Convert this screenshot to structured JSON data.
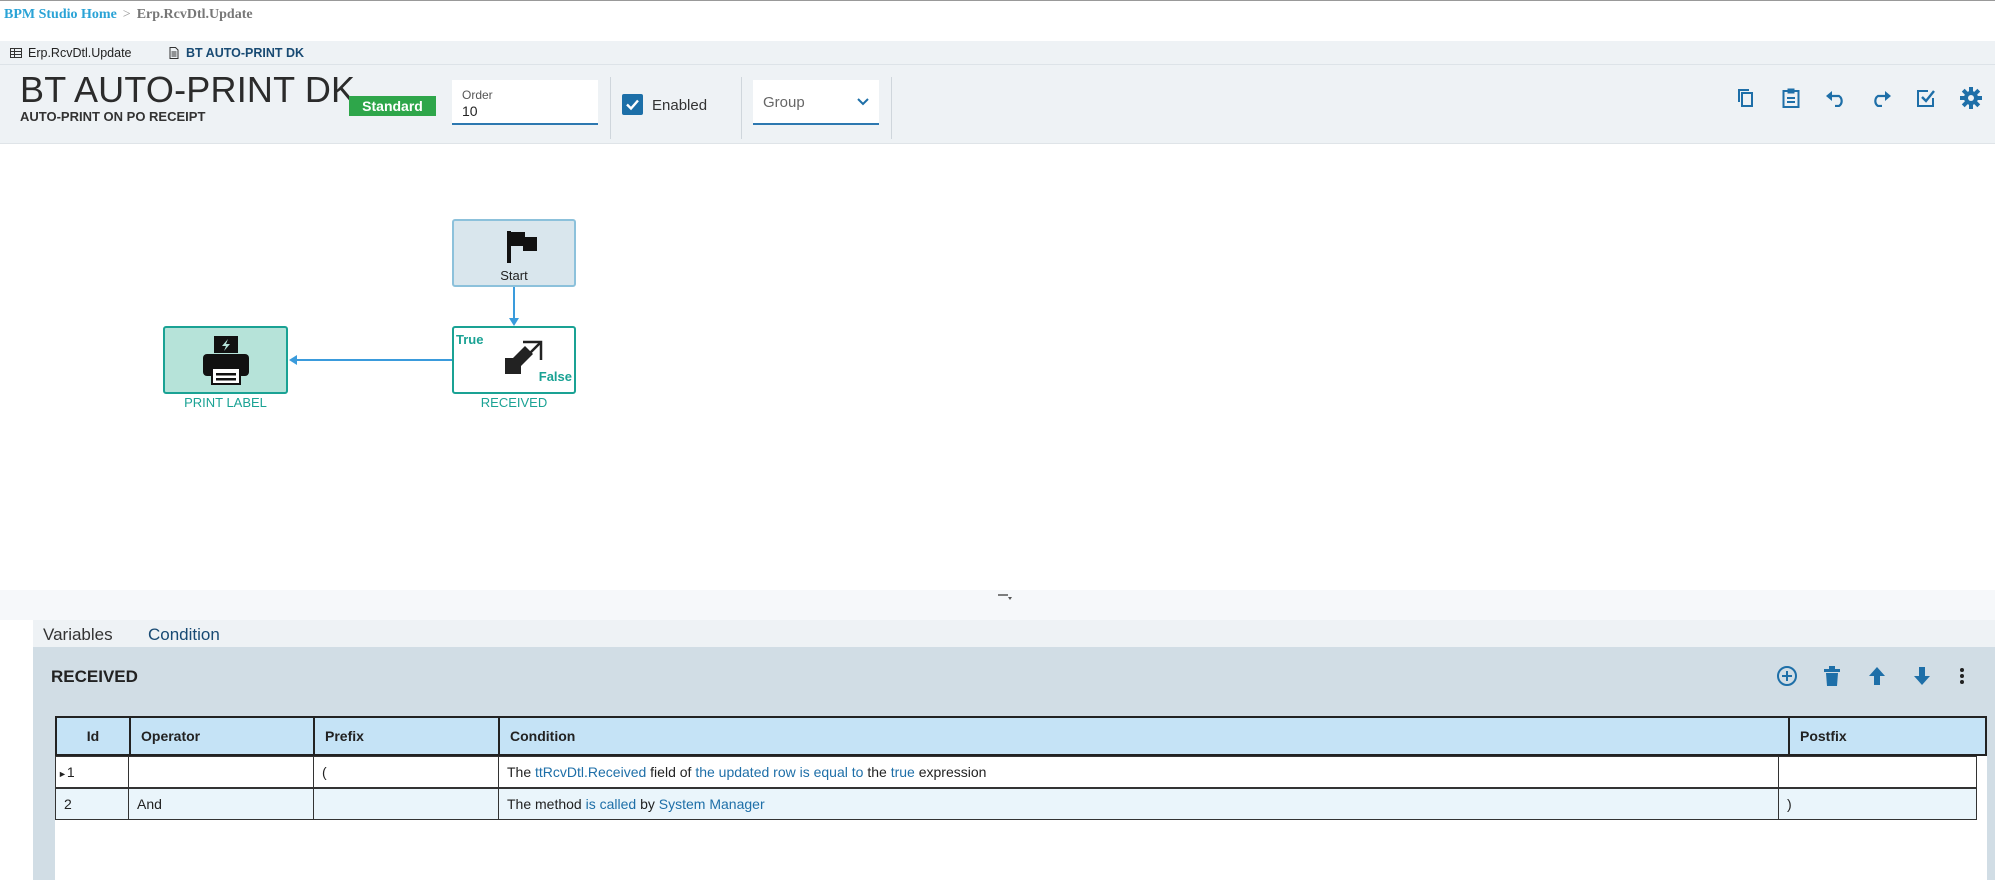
{
  "breadcrumb": {
    "home": "BPM Studio Home",
    "separator": ">",
    "current": "Erp.RcvDtl.Update"
  },
  "doc_tabs": [
    {
      "label": "Erp.RcvDtl.Update",
      "icon": "table-icon"
    },
    {
      "label": "BT AUTO-PRINT DK",
      "icon": "document-icon"
    }
  ],
  "header": {
    "title": "BT AUTO-PRINT DK",
    "subtitle": "AUTO-PRINT ON PO RECEIPT",
    "badge": "Standard",
    "order_label": "Order",
    "order_value": "10",
    "enabled_label": "Enabled",
    "enabled_checked": true,
    "group_placeholder": "Group",
    "toolbar_icons": [
      "copy-icon",
      "paste-icon",
      "undo-icon",
      "redo-icon",
      "validate-icon",
      "settings-icon"
    ]
  },
  "workflow": {
    "start_label": "Start",
    "condition_true_label": "True",
    "condition_false_label": "False",
    "condition_caption": "RECEIVED",
    "action_caption": "PRINT LABEL"
  },
  "bottom_tabs": {
    "variables": "Variables",
    "condition": "Condition"
  },
  "condition_panel": {
    "title": "RECEIVED",
    "actions": [
      "add-icon",
      "delete-icon",
      "move-up-icon",
      "move-down-icon",
      "more-icon"
    ],
    "columns": {
      "id": "Id",
      "operator": "Operator",
      "prefix": "Prefix",
      "condition": "Condition",
      "postfix": "Postfix"
    },
    "rows": [
      {
        "id": "1",
        "operator": "",
        "prefix": "(",
        "cond": {
          "t1": "The",
          "l1": "ttRcvDtl.Received",
          "t2": "field of",
          "l2": "the updated row",
          "l3": "is equal to",
          "t3": "the",
          "l4": "true",
          "t4": "expression"
        },
        "postfix": ""
      },
      {
        "id": "2",
        "operator": "And",
        "prefix": "",
        "cond": {
          "t1": "The method",
          "l1": "is called",
          "t2": "by",
          "l2": "System Manager"
        },
        "postfix": ")"
      }
    ]
  },
  "colors": {
    "accent": "#1e6fa8",
    "teal": "#1aa294",
    "badge": "#2ea64a",
    "header_bg": "#eef2f5",
    "grid_header": "#c5e3f6"
  }
}
